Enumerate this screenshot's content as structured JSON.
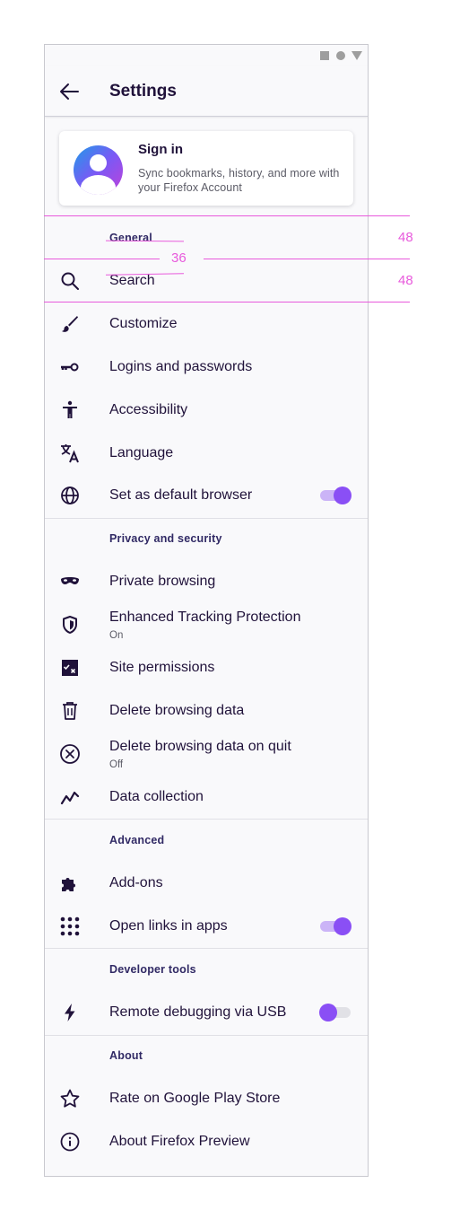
{
  "status_bar": {
    "icons": [
      "square-icon",
      "circle-icon",
      "triangle-icon"
    ]
  },
  "toolbar": {
    "back_icon": "arrow-left-icon",
    "title": "Settings"
  },
  "sign_in": {
    "title": "Sign in",
    "description": "Sync bookmarks, history, and more with your Firefox Account",
    "avatar_icon": "account-avatar-icon"
  },
  "sections": {
    "general": {
      "header": "General",
      "items": [
        {
          "label": "Search",
          "icon": "search-icon"
        },
        {
          "label": "Customize",
          "icon": "brush-icon"
        },
        {
          "label": "Logins and passwords",
          "icon": "key-icon"
        },
        {
          "label": "Accessibility",
          "icon": "accessibility-icon"
        },
        {
          "label": "Language",
          "icon": "translate-icon"
        },
        {
          "label": "Set as default browser",
          "icon": "globe-icon",
          "toggle": true
        }
      ]
    },
    "privacy": {
      "header": "Privacy and security",
      "items": [
        {
          "label": "Private browsing",
          "icon": "mask-icon"
        },
        {
          "label": "Enhanced Tracking Protection",
          "sub": "On",
          "icon": "shield-icon"
        },
        {
          "label": "Site permissions",
          "icon": "permissions-icon"
        },
        {
          "label": "Delete browsing data",
          "icon": "trash-icon"
        },
        {
          "label": "Delete browsing data on quit",
          "sub": "Off",
          "icon": "circle-x-icon"
        },
        {
          "label": "Data collection",
          "icon": "chart-line-icon"
        }
      ]
    },
    "advanced": {
      "header": "Advanced",
      "items": [
        {
          "label": "Add-ons",
          "icon": "puzzle-icon"
        },
        {
          "label": "Open links in apps",
          "icon": "apps-grid-icon",
          "toggle": true
        }
      ]
    },
    "developer": {
      "header": "Developer tools",
      "items": [
        {
          "label": "Remote debugging via USB",
          "icon": "bolt-icon",
          "toggle": false
        }
      ]
    },
    "about": {
      "header": "About",
      "items": [
        {
          "label": "Rate on Google Play Store",
          "icon": "star-icon"
        },
        {
          "label": "About Firefox Preview",
          "icon": "info-icon"
        }
      ]
    }
  },
  "annotations": {
    "header_height": "48",
    "gap": "36",
    "row_height": "48"
  },
  "colors": {
    "accent": "#8a4ff5",
    "accent_light": "#cbb4f7",
    "redline": "#e85adc",
    "text": "#20123a",
    "section_header": "#312a65"
  }
}
